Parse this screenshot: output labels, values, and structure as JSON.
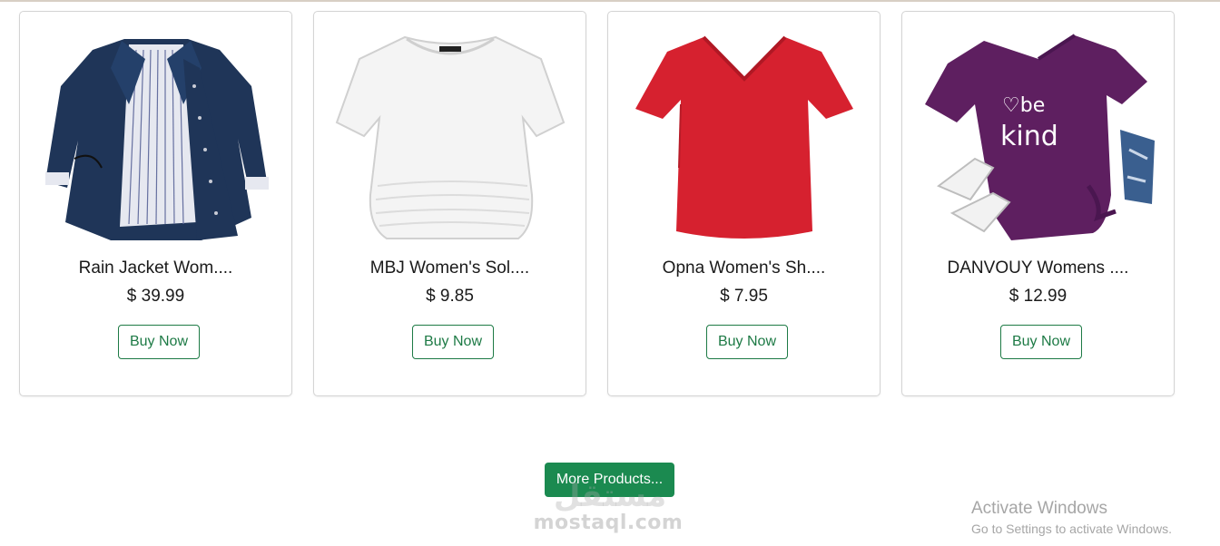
{
  "products": [
    {
      "title": "Rain Jacket Wom....",
      "price": "$ 39.99",
      "button": "Buy Now",
      "image_icon": "navy-jacket-icon",
      "color": "#1f3558"
    },
    {
      "title": "MBJ Women's Sol....",
      "price": "$ 9.85",
      "button": "Buy Now",
      "image_icon": "white-top-icon",
      "color": "#f4f4f4"
    },
    {
      "title": "Opna Women's Sh....",
      "price": "$ 7.95",
      "button": "Buy Now",
      "image_icon": "red-tshirt-icon",
      "color": "#d6212f"
    },
    {
      "title": "DANVOUY Womens ....",
      "price": "$ 12.99",
      "button": "Buy Now",
      "image_icon": "purple-tshirt-icon",
      "color": "#5e1f60",
      "print_text": "be kind"
    }
  ],
  "more_button": "More Products...",
  "watermark": {
    "arabic": "مستقل",
    "text": "mostaql.com"
  },
  "activation": {
    "title": "Activate Windows",
    "subtitle": "Go to Settings to activate Windows."
  },
  "colors": {
    "accent": "#1b8a50",
    "button_border": "#1d7a45"
  }
}
